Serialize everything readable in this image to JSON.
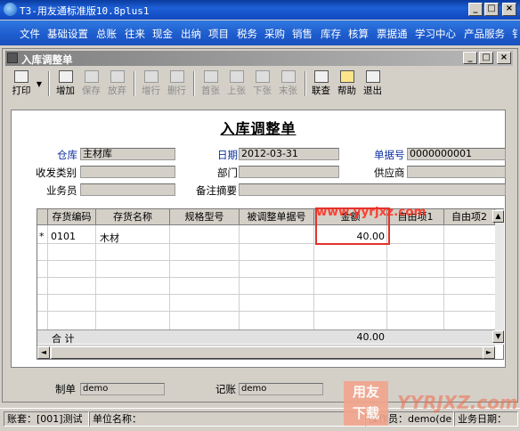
{
  "window": {
    "title": "T3-用友通标准版10.8plus1",
    "controls": [
      "_",
      "□",
      "×"
    ]
  },
  "menu": [
    "文件",
    "基础设置",
    "总账",
    "往来",
    "现金",
    "出纳",
    "项目",
    "税务",
    "采购",
    "销售",
    "库存",
    "核算",
    "票据通",
    "学习中心",
    "产品服务",
    "钅"
  ],
  "doc_window": {
    "title": "入库调整单",
    "controls": [
      "_",
      "□",
      "×"
    ]
  },
  "toolbar": {
    "print": "打印",
    "add": "增加",
    "save": "保存",
    "discard": "放弃",
    "add_row": "增行",
    "delete_row": "删行",
    "first": "首张",
    "prev": "上张",
    "next": "下张",
    "last": "末张",
    "lookup": "联查",
    "help": "帮助",
    "exit": "退出"
  },
  "form": {
    "title": "入库调整单",
    "warehouse_label": "仓库",
    "warehouse_value": "主材库",
    "date_label": "日期",
    "date_value": "2012-03-31",
    "doc_no_label": "单据号",
    "doc_no_value": "0000000001",
    "category_label": "收发类别",
    "category_value": "",
    "dept_label": "部门",
    "dept_value": "",
    "supplier_label": "供应商",
    "supplier_value": "",
    "clerk_label": "业务员",
    "clerk_value": "",
    "remark_label": "备注摘要",
    "remark_value": "",
    "maker_label": "制单",
    "maker_value": "demo",
    "poster_label": "记账",
    "poster_value": "demo"
  },
  "grid": {
    "columns": [
      "存货编码",
      "存货名称",
      "规格型号",
      "被调整单据号",
      "金额",
      "自由项1",
      "自由项2"
    ],
    "rows": [
      {
        "marker": "*",
        "code": "0101",
        "name": "木材",
        "spec": "",
        "adj_doc": "",
        "amount": "40.00",
        "free1": "",
        "free2": ""
      }
    ],
    "total_label": "合 计",
    "total_amount": "40.00"
  },
  "status": {
    "account": "账套：[001]测试",
    "unit": "单位名称：",
    "operator": "操作员：demo(de",
    "biz_date": "业务日期："
  },
  "watermarks": {
    "site_top": "www.yyrjxz.com",
    "logo_top": "用友",
    "logo_bottom": "下载",
    "site_bottom": "YYRJXZ.com"
  },
  "colors": {
    "titlebar": "#0f47c0",
    "menubar": "#1d5bcc",
    "highlight": "#e0332b"
  }
}
